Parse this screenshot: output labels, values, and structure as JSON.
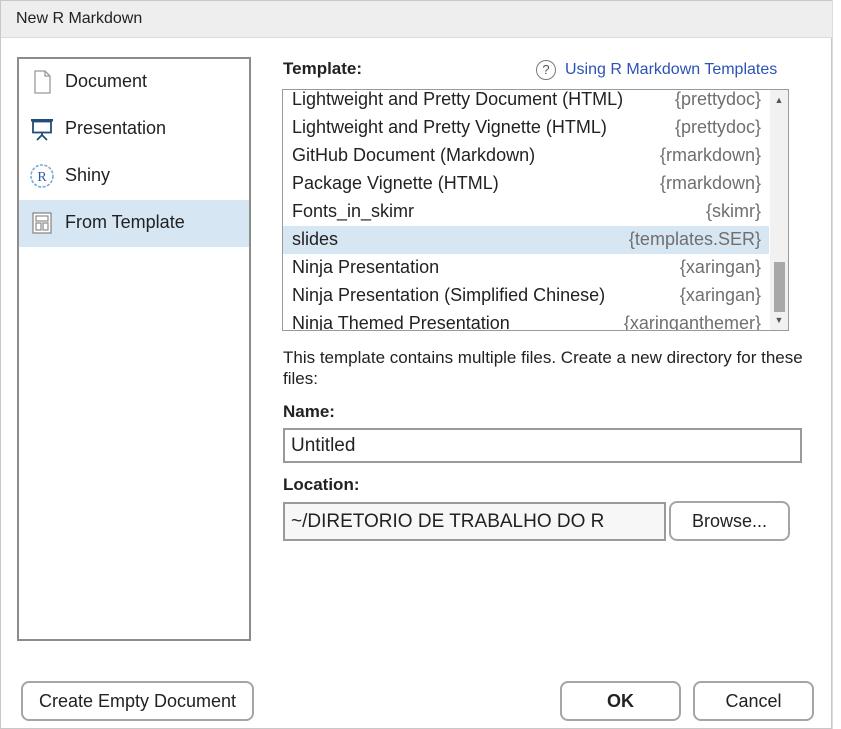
{
  "window": {
    "title": "New R Markdown"
  },
  "sidebar": {
    "items": [
      {
        "label": "Document",
        "icon": "document-icon",
        "selected": false
      },
      {
        "label": "Presentation",
        "icon": "presentation-easel-icon",
        "selected": false
      },
      {
        "label": "Shiny",
        "icon": "shiny-r-icon",
        "selected": false
      },
      {
        "label": "From Template",
        "icon": "template-icon",
        "selected": true
      }
    ]
  },
  "template": {
    "label": "Template:",
    "help_link": "Using R Markdown Templates",
    "items": [
      {
        "name": "Lightweight and Pretty Document (HTML)",
        "package": "{prettydoc}"
      },
      {
        "name": "Lightweight and Pretty Vignette (HTML)",
        "package": "{prettydoc}"
      },
      {
        "name": "GitHub Document (Markdown)",
        "package": "{rmarkdown}"
      },
      {
        "name": "Package Vignette (HTML)",
        "package": "{rmarkdown}"
      },
      {
        "name": "Fonts_in_skimr",
        "package": "{skimr}"
      },
      {
        "name": "slides",
        "package": "{templates.SER}",
        "selected": true
      },
      {
        "name": "Ninja Presentation",
        "package": "{xaringan}"
      },
      {
        "name": "Ninja Presentation (Simplified Chinese)",
        "package": "{xaringan}"
      },
      {
        "name": "Ninja Themed Presentation",
        "package": "{xaringanthemer}"
      }
    ]
  },
  "description": "This template contains multiple files. Create a new directory for these files:",
  "name_field": {
    "label": "Name:",
    "value": "Untitled"
  },
  "location": {
    "label": "Location:",
    "value": "~/DIRETORIO DE TRABALHO DO R",
    "browse_label": "Browse..."
  },
  "buttons": {
    "create_empty": "Create Empty Document",
    "ok": "OK",
    "cancel": "Cancel"
  },
  "colors": {
    "selected": "#d7e6f3",
    "link": "#2c52b6",
    "package_text": "#6f6f6f"
  }
}
